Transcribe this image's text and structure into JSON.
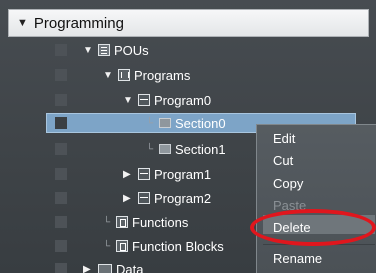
{
  "panel": {
    "title": "Programming",
    "title_expander": "▼"
  },
  "tree": {
    "pous": {
      "label": "POUs",
      "expander": "▼"
    },
    "programs": {
      "label": "Programs",
      "expander": "▼"
    },
    "program0": {
      "label": "Program0",
      "expander": "▼"
    },
    "section0": {
      "label": "Section0",
      "connector": "└",
      "selected": true
    },
    "section1": {
      "label": "Section1",
      "connector": "└"
    },
    "program1": {
      "label": "Program1",
      "expander": "▶"
    },
    "program2": {
      "label": "Program2",
      "expander": "▶"
    },
    "functions": {
      "label": "Functions",
      "connector": "└"
    },
    "function_blocks": {
      "label": "Function Blocks",
      "connector": "└"
    },
    "data": {
      "label": "Data",
      "expander": "▶"
    }
  },
  "context_menu": {
    "items": [
      {
        "label": "Edit",
        "enabled": true
      },
      {
        "label": "Cut",
        "enabled": true
      },
      {
        "label": "Copy",
        "enabled": true
      },
      {
        "label": "Paste",
        "enabled": false
      },
      {
        "label": "Delete",
        "enabled": true,
        "highlighted": true
      },
      {
        "label": "Rename",
        "enabled": true
      }
    ]
  },
  "colors": {
    "selection": "#7da4c7",
    "highlight_ring": "#e0161d",
    "background": "#3f4448"
  },
  "icons": {
    "pous": "pous-folder-icon",
    "programs": "programs-folder-icon",
    "program": "program-icon",
    "section": "section-icon",
    "functions": "functions-icon",
    "function_blocks": "function-blocks-icon",
    "data": "data-icon"
  }
}
